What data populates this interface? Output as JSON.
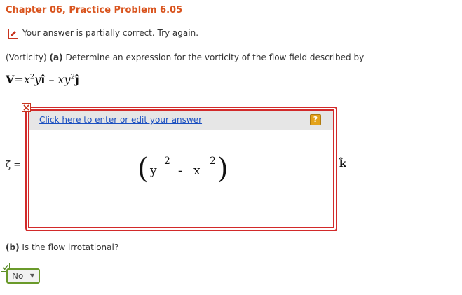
{
  "problem": {
    "title": "Chapter 06, Practice Problem 6.05",
    "status_text": "Your answer is partially correct.  Try again.",
    "question_prefix": "(Vorticity)",
    "question_part_a": "(a)",
    "question_text": "Determine an expression for the vorticity of the flow field described by",
    "equation": {
      "lhs": "V",
      "eq": "=",
      "term1": "x",
      "term1_exp": "2",
      "term1_rest": "y",
      "ihat": "î",
      "minus": " – ",
      "term2": "xy",
      "term2_exp": "2",
      "jhat": "ĵ"
    }
  },
  "answer_a": {
    "symbol": "ζ =",
    "edit_link": "Click here to enter or edit your answer",
    "help_label": "?",
    "expression": {
      "open": "(",
      "y": "y",
      "y_exp": "2",
      "minus": "-",
      "x": "x",
      "x_exp": "2",
      "close": ")"
    },
    "unit_vector": "k̂"
  },
  "part_b": {
    "label": "(b)",
    "question": "Is the flow irrotational?",
    "selected_value": "No",
    "arrow": "▼"
  },
  "colors": {
    "title": "#d9541e",
    "error_border": "#d22a2a",
    "link": "#1a4fc0",
    "correct_border": "#6a9a2a",
    "help": "#e3a21a"
  }
}
